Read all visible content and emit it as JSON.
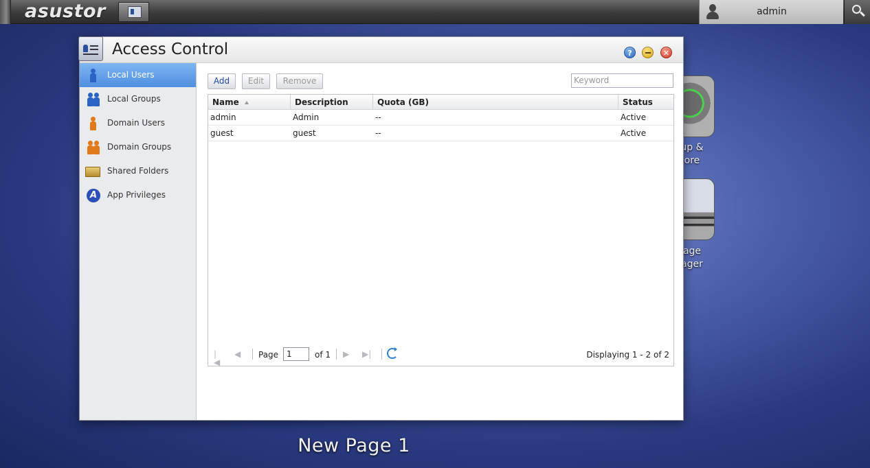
{
  "topbar": {
    "brand": "asustor",
    "user": "admin"
  },
  "desktop": {
    "apps": [
      {
        "label_line1": "up &",
        "label_line2": "ore"
      },
      {
        "label_line1": "age",
        "label_line2": "ager"
      }
    ],
    "page_label": "New Page 1"
  },
  "window": {
    "title": "Access Control",
    "help_glyph": "?",
    "close_glyph": "✕"
  },
  "sidebar": {
    "items": [
      {
        "label": "Local Users",
        "icon": "user-icon"
      },
      {
        "label": "Local Groups",
        "icon": "users-icon"
      },
      {
        "label": "Domain Users",
        "icon": "domain-user-icon"
      },
      {
        "label": "Domain Groups",
        "icon": "domain-group-icon"
      },
      {
        "label": "Shared Folders",
        "icon": "folder-icon"
      },
      {
        "label": "App Privileges",
        "icon": "app-icon"
      }
    ]
  },
  "toolbar": {
    "add": "Add",
    "edit": "Edit",
    "remove": "Remove",
    "keyword_placeholder": "Keyword"
  },
  "table": {
    "headers": [
      "Name",
      "Description",
      "Quota (GB)",
      "Status"
    ],
    "rows": [
      [
        "admin",
        "Admin",
        "--",
        "Active"
      ],
      [
        "guest",
        "guest",
        "--",
        "Active"
      ]
    ]
  },
  "pager": {
    "page_label": "Page",
    "page_value": "1",
    "of_label": "of 1",
    "displaying": "Displaying 1 - 2 of 2"
  }
}
